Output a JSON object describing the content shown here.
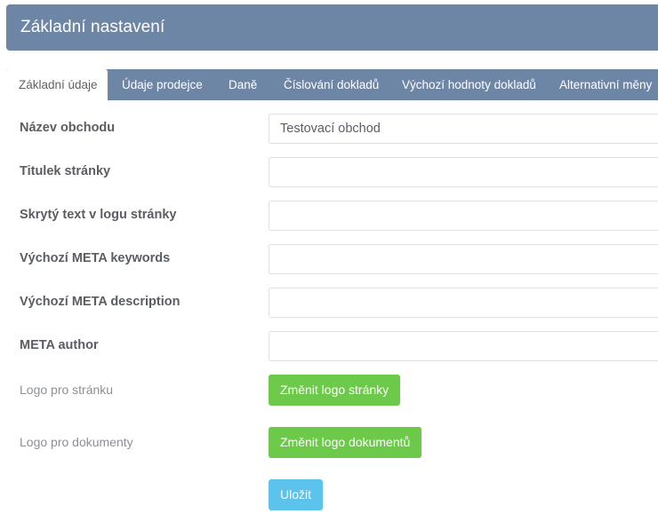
{
  "header": {
    "title": "Základní nastavení"
  },
  "tabs": [
    {
      "label": "Základní údaje",
      "active": true
    },
    {
      "label": "Údaje prodejce",
      "active": false
    },
    {
      "label": "Daně",
      "active": false
    },
    {
      "label": "Číslování dokladů",
      "active": false
    },
    {
      "label": "Výchozí hodnoty dokladů",
      "active": false
    },
    {
      "label": "Alternativní měny",
      "active": false
    }
  ],
  "form": {
    "shop_name": {
      "label": "Název obchodu",
      "value": "Testovací obchod"
    },
    "page_title": {
      "label": "Titulek stránky",
      "value": ""
    },
    "hidden_logo_text": {
      "label": "Skrytý text v logu stránky",
      "value": ""
    },
    "meta_keywords": {
      "label": "Výchozí META keywords",
      "value": ""
    },
    "meta_description": {
      "label": "Výchozí META description",
      "value": ""
    },
    "meta_author": {
      "label": "META author",
      "value": ""
    },
    "page_logo": {
      "label": "Logo pro stránku",
      "button": "Změnit logo stránky"
    },
    "document_logo": {
      "label": "Logo pro dokumenty",
      "button": "Změnit logo dokumentů"
    },
    "save_button": "Uložit"
  },
  "colors": {
    "header_bg": "#6e86a6",
    "green_button": "#6dc94a",
    "blue_button": "#5bc3ec"
  }
}
